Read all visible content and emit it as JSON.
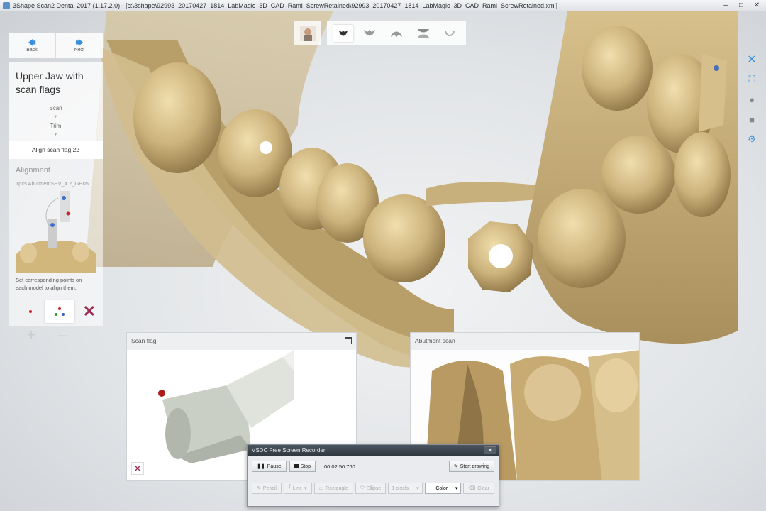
{
  "window": {
    "title": "3Shape Scan2 Dental 2017 (1.17.2.0) - [c:\\3shape\\92993_20170427_1814_LabMagic_3D_CAD_Rami_ScrewRetained\\92993_20170427_1814_LabMagic_3D_CAD_Rami_ScrewRetained.xml]"
  },
  "nav": {
    "back_label": "Back",
    "next_label": "Next"
  },
  "workflow": {
    "title_line1": "Upper Jaw with",
    "title_line2": "scan flags",
    "steps": [
      "Scan",
      "Trim"
    ],
    "active_step": "Align scan flag 22"
  },
  "alignment": {
    "heading": "Alignment",
    "item": "1pcs AbutmentSEV_4.2_GH05",
    "instruction_line1": "Set corresponding points on",
    "instruction_line2": "each model to align them."
  },
  "panels": {
    "scan_flag_title": "Scan flag",
    "abutment_scan_title": "Abutment scan"
  },
  "recorder": {
    "title": "VSDC Free Screen Recorder",
    "pause_label": "Pause",
    "stop_label": "Stop",
    "elapsed": "00:02:50.760",
    "start_drawing_label": "Start drawing",
    "pencil_label": "Pencil",
    "line_label": "Line",
    "rectangle_label": "Rectangle",
    "ellipse_label": "Ellipse",
    "width_value": "1 pixels",
    "color_label": "Color",
    "clear_label": "Clear"
  },
  "colors": {
    "accent": "#3b8fd8",
    "delete": "#9a2b4d",
    "model": "#c9b07a"
  }
}
